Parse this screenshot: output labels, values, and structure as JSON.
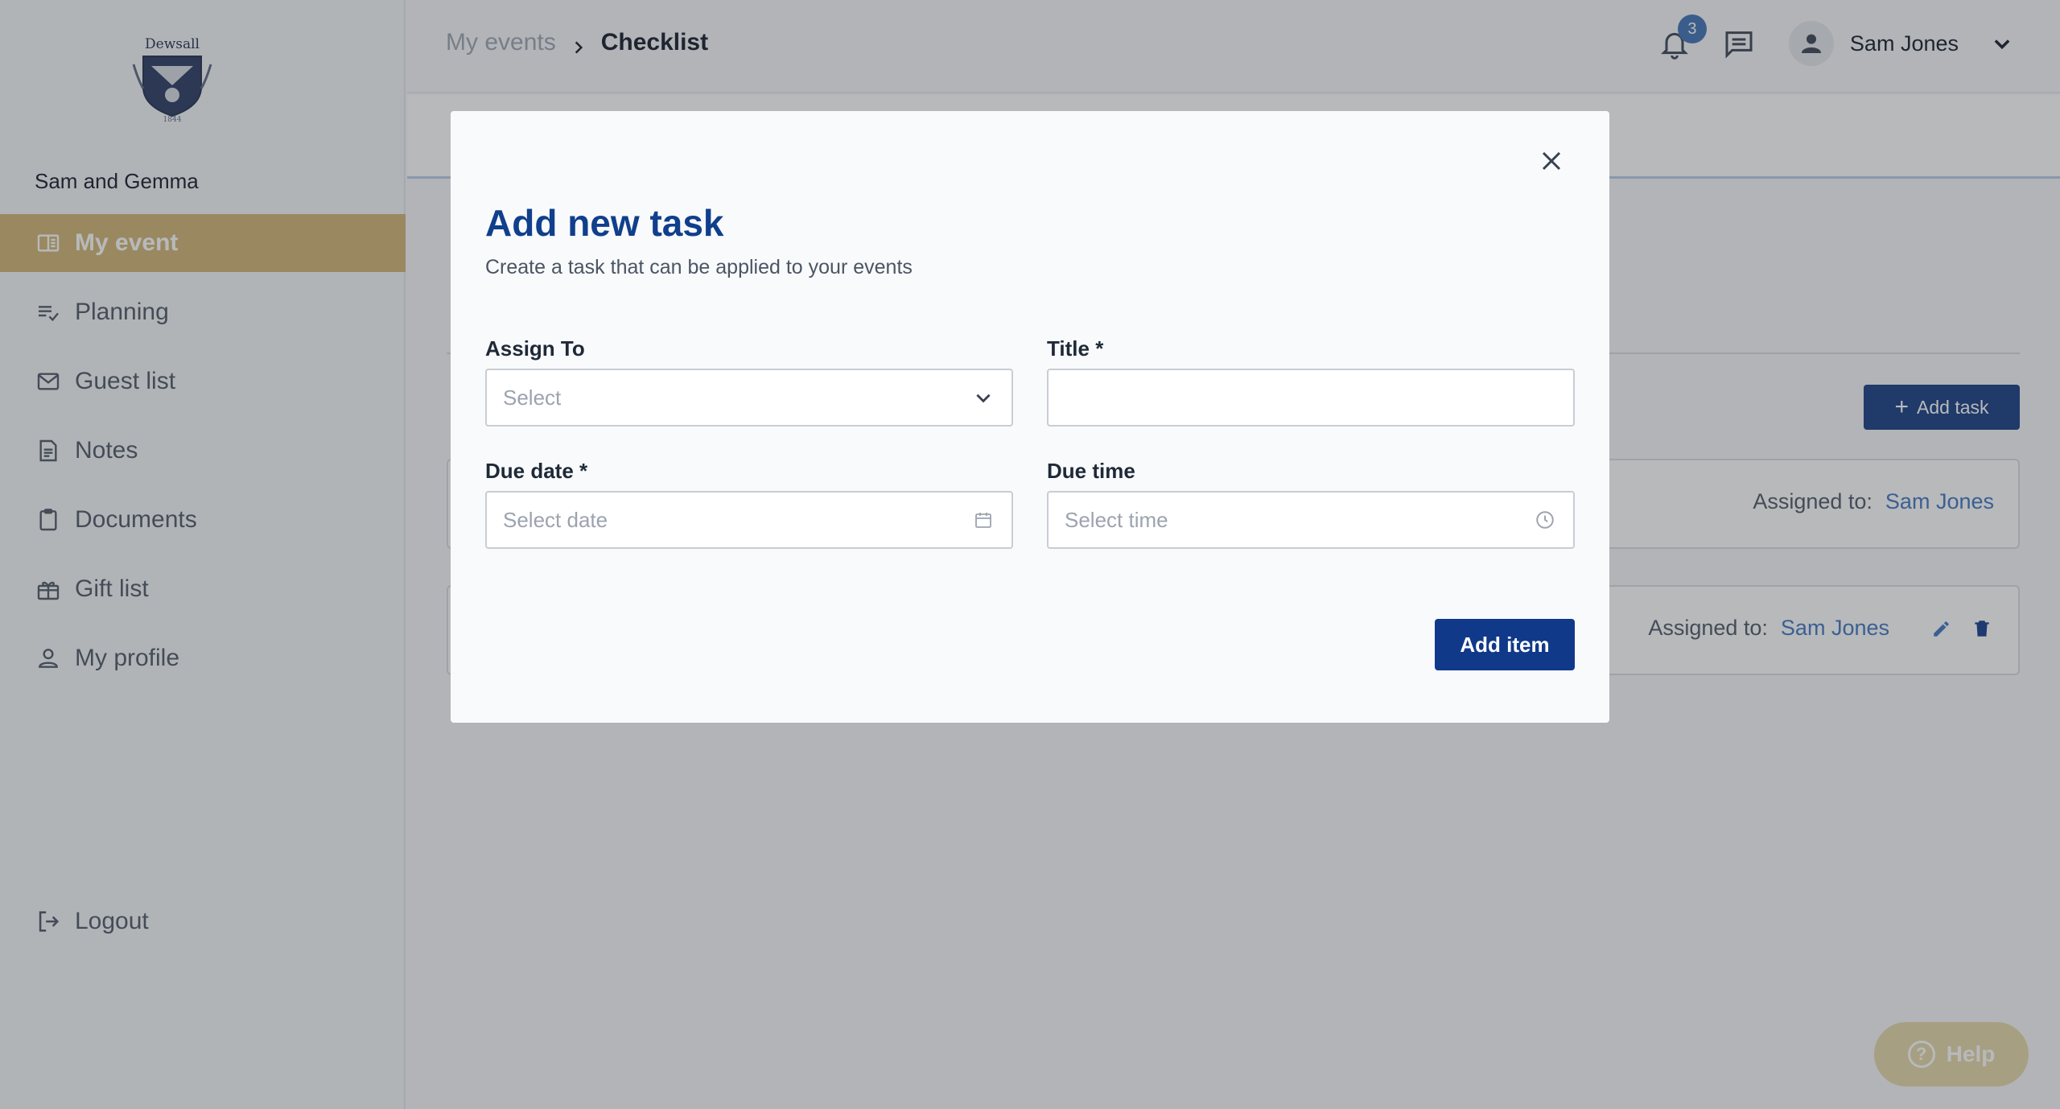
{
  "app": {
    "logo_text": "Dewsall",
    "logo_year": "1844",
    "event_name": "Sam and Gemma"
  },
  "sidebar": {
    "items": [
      {
        "label": "My event",
        "icon": "book-open-icon",
        "active": true
      },
      {
        "label": "Planning",
        "icon": "list-check-icon",
        "active": false
      },
      {
        "label": "Guest list",
        "icon": "mail-icon",
        "active": false
      },
      {
        "label": "Notes",
        "icon": "note-icon",
        "active": false
      },
      {
        "label": "Documents",
        "icon": "clipboard-icon",
        "active": false
      },
      {
        "label": "Gift list",
        "icon": "gift-icon",
        "active": false
      },
      {
        "label": "My profile",
        "icon": "person-icon",
        "active": false
      }
    ],
    "logout_label": "Logout"
  },
  "header": {
    "breadcrumb_parent": "My events",
    "breadcrumb_current": "Checklist",
    "notification_count": "3",
    "user_name": "Sam Jones"
  },
  "background": {
    "add_task_label": "Add task",
    "assigned_prefix": "Assigned to:",
    "task1_assignee": "Sam Jones",
    "task2_assignee": "Sam Jones"
  },
  "help": {
    "label": "Help"
  },
  "modal": {
    "title": "Add new task",
    "subtitle": "Create a task that can be applied to your events",
    "assign_to_label": "Assign To",
    "assign_to_placeholder": "Select",
    "title_label": "Title *",
    "title_value": "",
    "due_date_label": "Due date *",
    "due_date_placeholder": "Select date",
    "due_time_label": "Due time",
    "due_time_placeholder": "Select time",
    "submit_label": "Add item"
  },
  "colors": {
    "accent_gold": "#d2b571",
    "primary_blue": "#10398a",
    "title_blue": "#103f8c",
    "link_blue": "#3e72c0"
  }
}
